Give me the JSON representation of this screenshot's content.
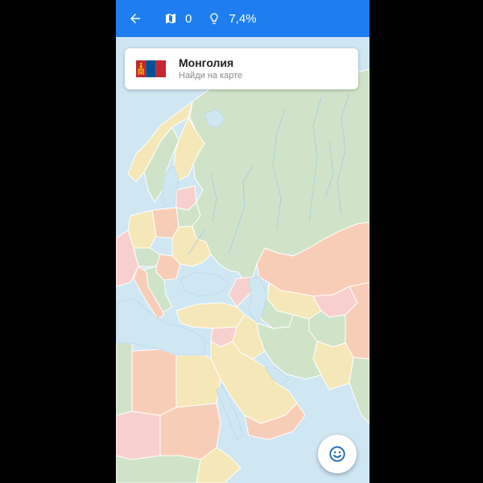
{
  "header": {
    "back_icon": "arrow-left-icon",
    "maps_icon": "map-icon",
    "maps_count": "0",
    "hint_icon": "lightbulb-icon",
    "hint_percent": "7,4%"
  },
  "task": {
    "country": "Монголия",
    "instruction": "Найди на карте",
    "flag_icon": "flag-mongolia-icon"
  },
  "fab": {
    "icon": "smiley-icon"
  },
  "colors": {
    "toolbar": "#1e7ef0",
    "sea": "#cfe6f3",
    "land_green": "#cfe3c8",
    "land_orange": "#f8cdb8",
    "land_yellow": "#f6e7b8",
    "land_pink": "#f7d0cd",
    "border": "#ffffff",
    "river": "#9fcde6"
  }
}
